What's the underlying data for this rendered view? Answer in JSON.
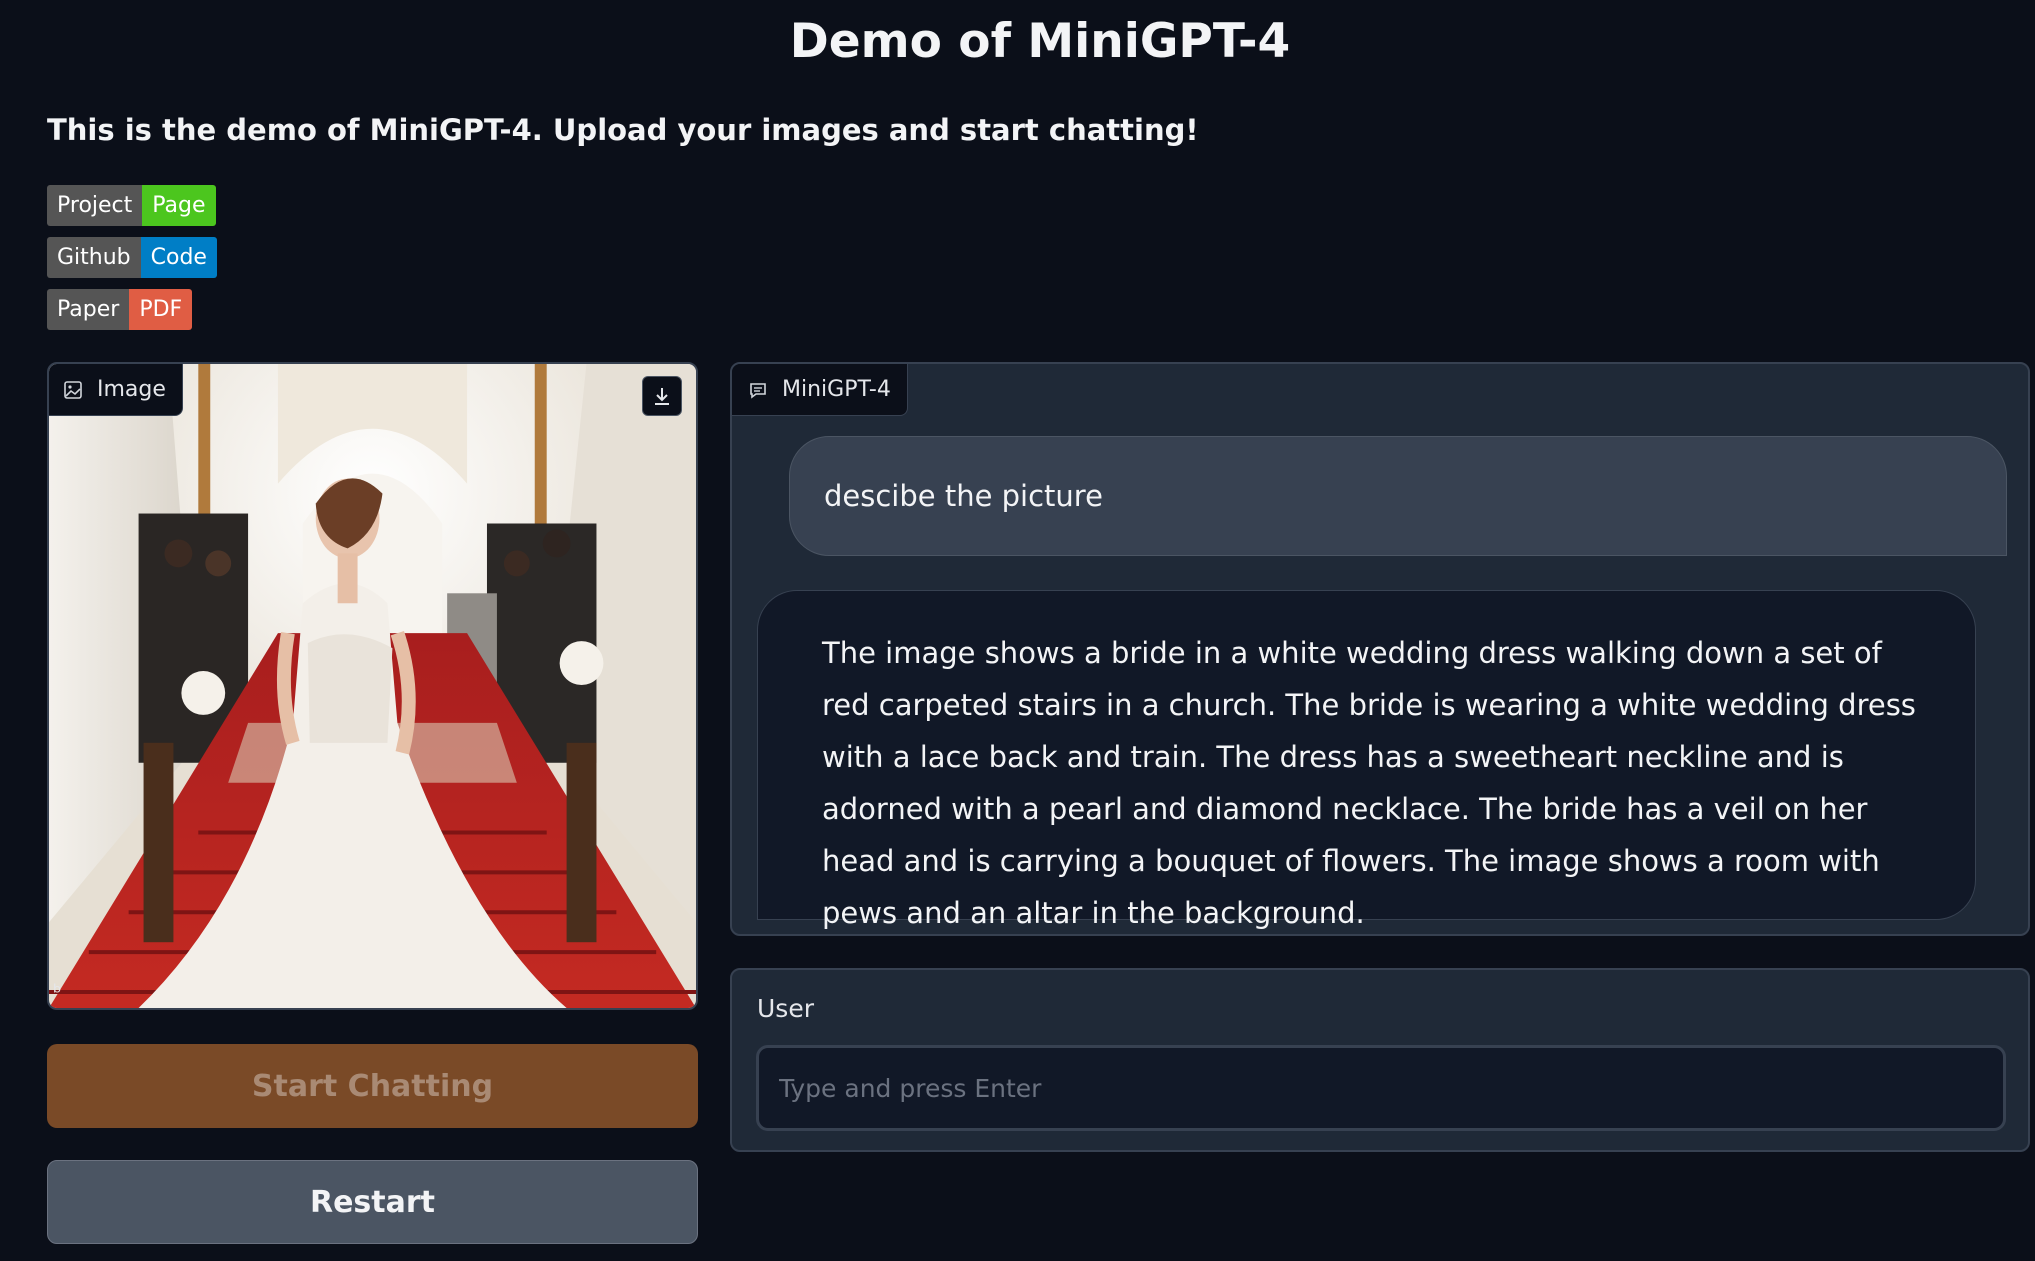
{
  "header": {
    "title": "Demo of MiniGPT-4",
    "subtitle": "This is the demo of MiniGPT-4. Upload your images and start chatting!"
  },
  "badges": [
    {
      "left": "Project",
      "right": "Page",
      "color": "#4cc61e"
    },
    {
      "left": "Github",
      "right": "Code",
      "color": "#007ec6"
    },
    {
      "left": "Paper",
      "right": "PDF",
      "color": "#e05d44"
    }
  ],
  "image_panel": {
    "label": "Image",
    "icon": "image-icon",
    "download_icon": "download-icon"
  },
  "buttons": {
    "start": "Start Chatting",
    "restart": "Restart"
  },
  "chat": {
    "label": "MiniGPT-4",
    "icon": "chat-icon",
    "messages": [
      {
        "role": "user",
        "text": "descibe the picture"
      },
      {
        "role": "bot",
        "text": "The image shows a bride in a white wedding dress walking down a set of red carpeted stairs in a church. The bride is wearing a white wedding dress with a lace back and train. The dress has a sweetheart neckline and is adorned with a pearl and diamond necklace. The bride has a veil on her head and is carrying a bouquet of flowers. The image shows a room with pews and an altar in the background."
      }
    ]
  },
  "user_input": {
    "label": "User",
    "placeholder": "Type and press Enter",
    "value": ""
  },
  "colors": {
    "background": "#0b0f19",
    "panel": "#1f2937",
    "start_button": "#7a4a27",
    "restart_button": "#4b5563"
  }
}
